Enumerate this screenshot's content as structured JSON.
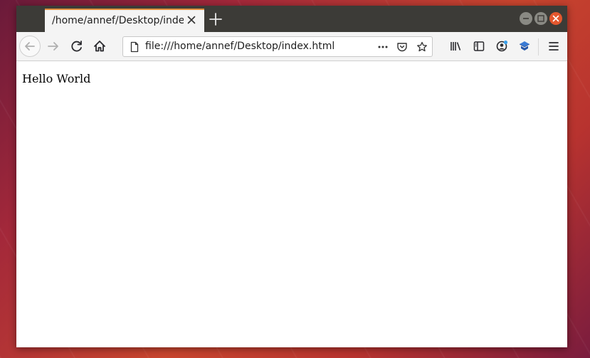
{
  "browser": {
    "tab": {
      "title": "/home/annef/Desktop/index.html"
    },
    "urlbar": {
      "url": "file:///home/annef/Desktop/index.html"
    },
    "icons": {
      "back": "arrow-left-icon",
      "forward": "arrow-right-icon",
      "reload": "reload-icon",
      "home": "home-icon",
      "page": "page-icon",
      "page_actions": "ellipsis-icon",
      "pocket": "pocket-icon",
      "bookmark": "star-icon",
      "library": "library-icon",
      "sidebar": "sidebar-icon",
      "account": "account-icon",
      "extension": "extension-icon",
      "menu": "hamburger-menu-icon"
    },
    "colors": {
      "tab_accent": "#e08d3c",
      "titlebar": "#3c3b37",
      "close_button": "#e4572e",
      "notification_dot": "#3aa0ea"
    }
  },
  "page": {
    "body_text": "Hello World"
  }
}
